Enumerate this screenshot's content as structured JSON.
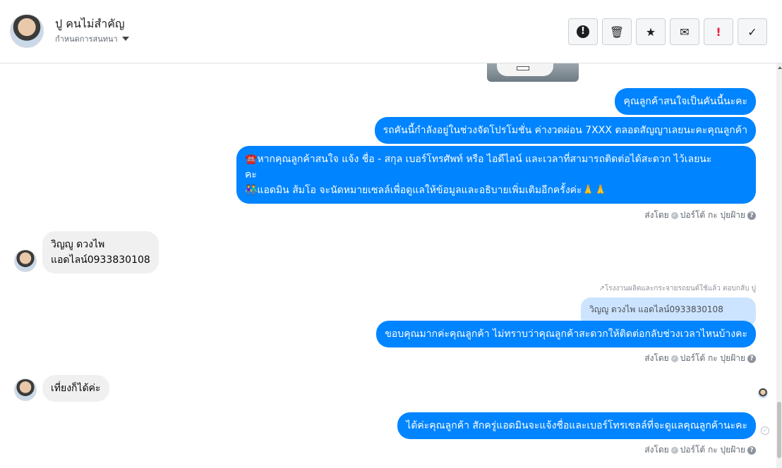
{
  "header": {
    "name": "ปู คนไม่สำคัญ",
    "subtitle": "กำหนดการสนทนา"
  },
  "toolbar": {
    "spam_icon": "!",
    "delete_icon": "🗑",
    "star_icon": "★",
    "mail_icon": "✉",
    "important_icon": "!",
    "done_icon": "✓"
  },
  "messages": {
    "m1": "คุณลูกค้าสนใจเป็นคันนี้นะคะ",
    "m2": "รถคันนี้กำลังอยู่ในช่วงจัดโปรโมชั่น ค่างวดผ่อน 7XXX ตลอดสัญญาเลยนะคะคุณลูกค้า",
    "m3_line1": "☎️หากคุณลูกค้าสนใจ แจ้ง ชื่อ - สกุล เบอร์โทรศัพท์ หรือ ไอดีไลน์ และเวลาที่สามารถติดต่อได้สะดวก ไว้เลยนะ",
    "m3_line2": "คะ",
    "m3_line3": "👫แอดมิน ส้มโอ จะนัดหมายเซลล์เพื่อดูแลให้ข้อมูลและอธิบายเพิ่มเติมอีกครั้งค่ะ🙏🙏",
    "sent_by_1": "ส่งโดย",
    "sender_1": "ปอร์โต้ กะ ปุยฝ้าย",
    "in1_line1": "วิญญู ดวงไพ",
    "in1_line2": "แอดไลน์0933830108",
    "reply_note": "↗โรงงานผลิตและกระจายรถยนต์ใช้แล้ว ตอบกลับ ปู",
    "quoted": "วิญญู ดวงไพ แอดไลน์0933830108",
    "m4": "ขอบคุณมากค่ะคุณลูกค้า ไม่ทราบว่าคุณลูกค้าสะดวกให้ติดต่อกลับช่วงเวลาไหนบ้างคะ",
    "sent_by_2": "ส่งโดย",
    "sender_2": "ปอร์โต้ กะ ปุยฝ้าย",
    "in2": "เที่ยงก็ได้ค่ะ",
    "m5": "ได้ค่ะคุณลูกค้า สักครู่แอดมินจะแจ้งชื่อและเบอร์โทรเซลล์ที่จะดูแลคุณลูกค้านะคะ",
    "sent_by_3": "ส่งโดย",
    "sender_3": "ปอร์โต้ กะ ปุยฝ้าย"
  },
  "colors": {
    "outgoing": "#0084ff",
    "incoming": "#f1f0f0",
    "quoted": "#cce4ff"
  }
}
